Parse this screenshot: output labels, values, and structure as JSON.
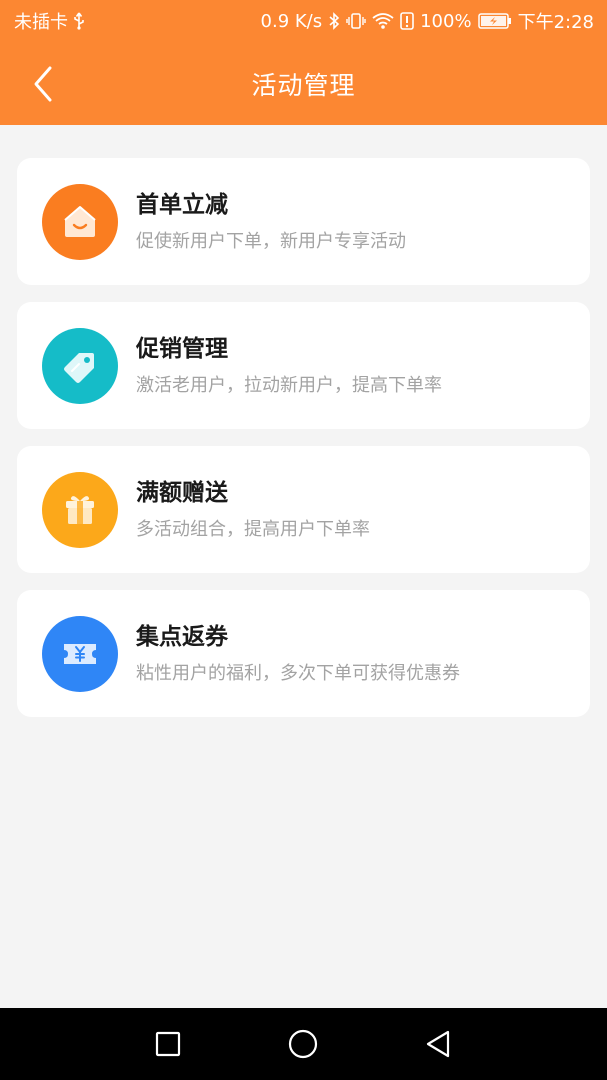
{
  "status_bar": {
    "carrier": "未插卡",
    "network_speed": "0.9 K/s",
    "battery": "100%",
    "time": "下午2:28",
    "icons": [
      "usb-icon",
      "bluetooth-icon",
      "vibrate-icon",
      "wifi-icon",
      "alert-icon",
      "battery-charging-icon"
    ]
  },
  "header": {
    "title": "活动管理",
    "back_icon": "chevron-left-icon"
  },
  "activities": [
    {
      "title": "首单立减",
      "desc": "促使新用户下单，新用户专享活动",
      "icon": "house-icon",
      "color": "#fa7d20"
    },
    {
      "title": "促销管理",
      "desc": "激活老用户，拉动新用户，提高下单率",
      "icon": "tag-icon",
      "color": "#15bcc8"
    },
    {
      "title": "满额赠送",
      "desc": "多活动组合，提高用户下单率",
      "icon": "gift-icon",
      "color": "#fca81a"
    },
    {
      "title": "集点返券",
      "desc": "粘性用户的福利，多次下单可获得优惠券",
      "icon": "yen-ticket-icon",
      "color": "#2f86f6"
    }
  ],
  "nav_bar": {
    "buttons": [
      "recent-apps-icon",
      "home-icon",
      "back-icon"
    ]
  },
  "colors": {
    "brand": "#fc8732",
    "background": "#f4f4f4"
  }
}
